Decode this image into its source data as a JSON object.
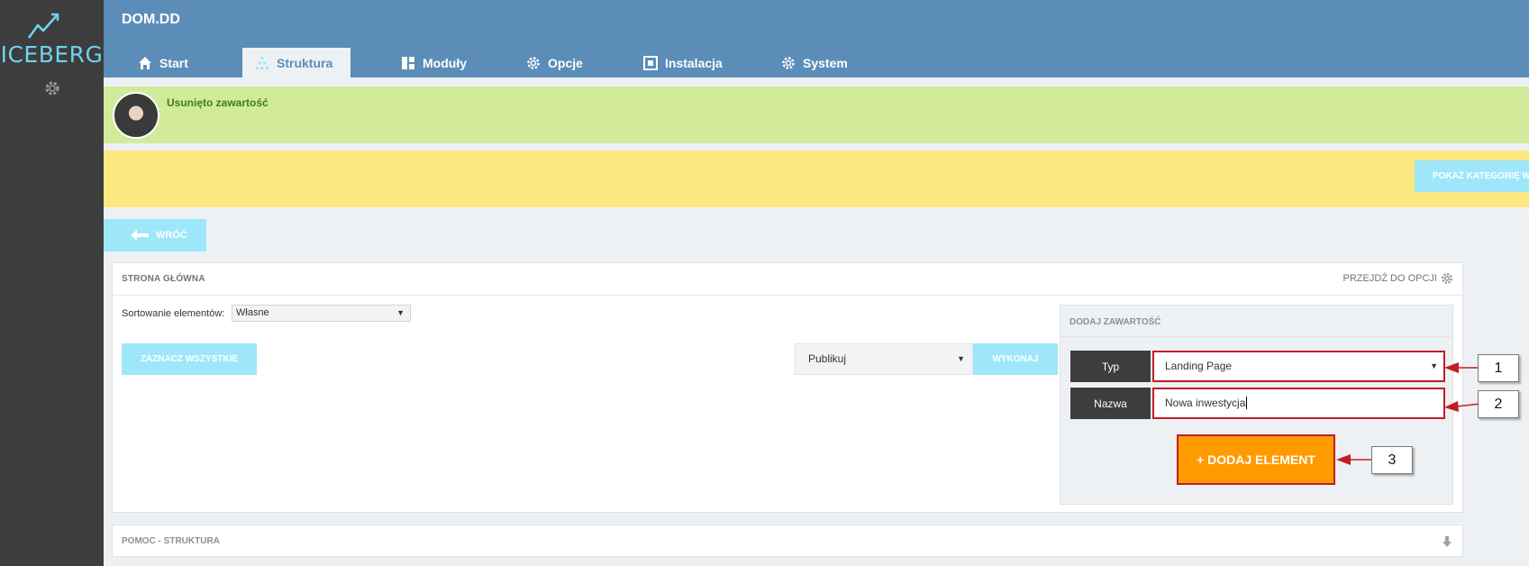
{
  "sidebar": {
    "logo_text": "ICEBERG",
    "settings_icon": "gear-icon"
  },
  "header": {
    "site_title": "DOM.DD",
    "tabs": [
      {
        "label": "Start",
        "icon": "home-icon",
        "active": false
      },
      {
        "label": "Struktura",
        "icon": "structure-icon",
        "active": true
      },
      {
        "label": "Moduły",
        "icon": "modules-icon",
        "active": false
      },
      {
        "label": "Opcje",
        "icon": "gear-icon",
        "active": false
      },
      {
        "label": "Instalacja",
        "icon": "install-icon",
        "active": false
      },
      {
        "label": "System",
        "icon": "gear-icon",
        "active": false
      }
    ]
  },
  "notice": {
    "text": "Usunięto zawartość"
  },
  "yellow_bar": {
    "button_label": "POKAŻ KATEGORIĘ W"
  },
  "back_button": {
    "label": "WRÓĆ"
  },
  "panel": {
    "title": "STRONA GŁÓWNA",
    "goto_options": "PRZEJDŹ DO OPCJI",
    "sort_label": "Sortowanie elementów:",
    "sort_value": "Własne",
    "select_all": "ZAZNACZ WSZYSTKIE",
    "action_value": "Publikuj",
    "execute": "WYKONAJ"
  },
  "add_content": {
    "title": "DODAJ ZAWARTOŚĆ",
    "type_label": "Typ",
    "type_value": "Landing Page",
    "name_label": "Nazwa",
    "name_value": "Nowa inwestycja",
    "add_button": "+ DODAJ ELEMENT"
  },
  "help": {
    "title": "POMOC - STRUKTURA"
  },
  "annotations": {
    "callout_1": "1",
    "callout_2": "2",
    "callout_3": "3"
  },
  "colors": {
    "sidebar": "#3d3d3d",
    "header": "#5b8db8",
    "notice_green": "#d1eb9a",
    "notice_yellow": "#fbe87f",
    "light_blue_button": "#9ee7fb",
    "add_button": "#ff9a00",
    "highlight_red": "#c41c25"
  }
}
